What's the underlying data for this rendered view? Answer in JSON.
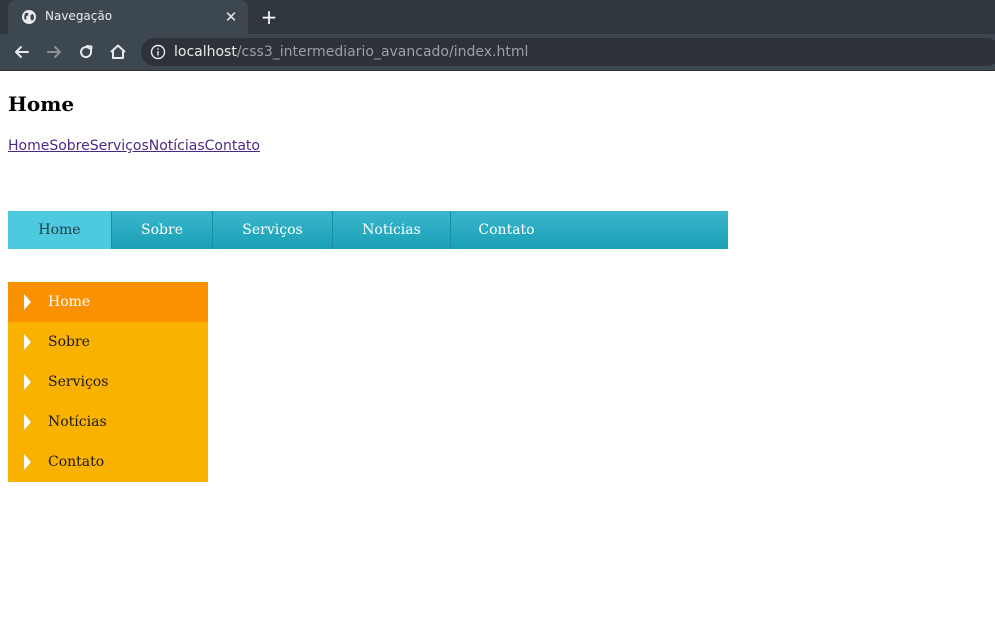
{
  "browser": {
    "tab_title": "Navegação",
    "tab_close_icon": "close-icon",
    "new_tab_icon": "plus-icon",
    "url_host": "localhost",
    "url_path": "/css3_intermediario_avancado/index.html"
  },
  "page": {
    "heading": "Home",
    "plain_nav": [
      "Home",
      "Sobre",
      "Serviços",
      "Notícias",
      "Contato"
    ],
    "horizontal_nav": {
      "items": [
        "Home",
        "Sobre",
        "Serviços",
        "Notícias",
        "Contato"
      ],
      "active": "Home",
      "color": "#19a0b6",
      "active_color": "#4ecadf"
    },
    "vertical_nav": {
      "items": [
        "Home",
        "Sobre",
        "Serviços",
        "Notícias",
        "Contato"
      ],
      "active": "Home",
      "color": "#f9b200",
      "active_color": "#fa9100"
    }
  }
}
